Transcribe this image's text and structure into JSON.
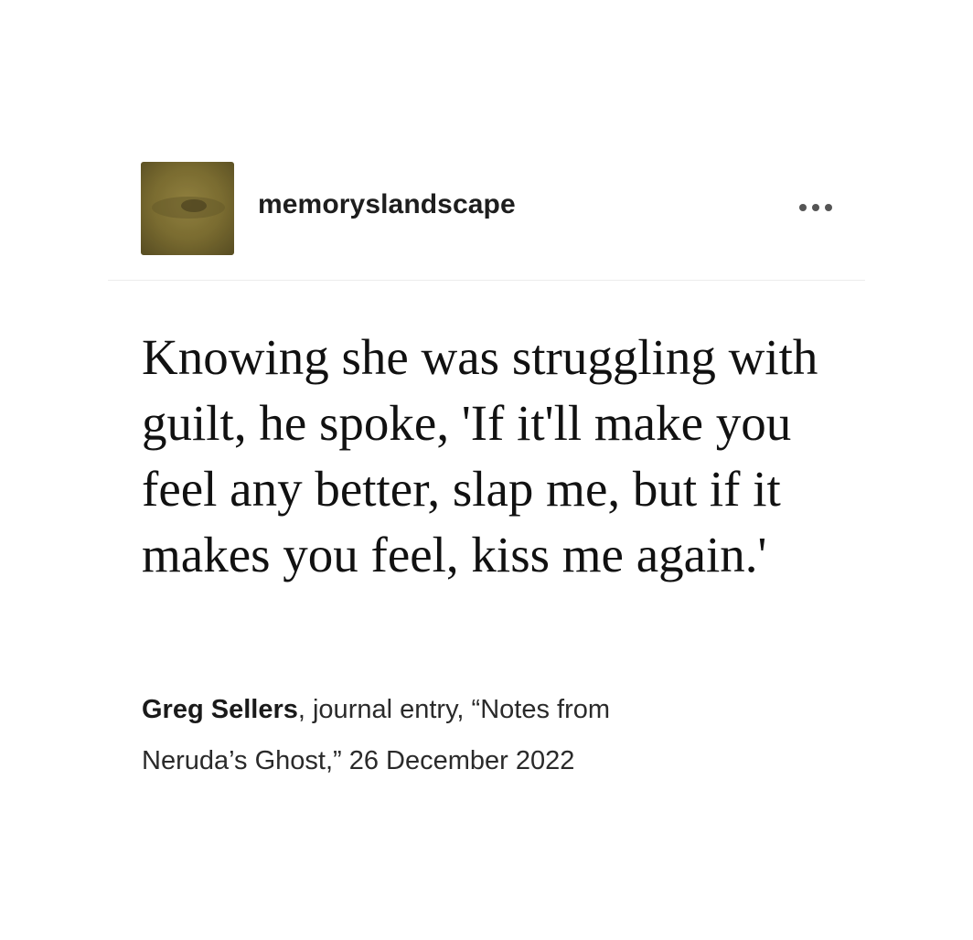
{
  "post": {
    "username": "memoryslandscape",
    "more_icon": "ellipsis-horizontal-icon",
    "quote": "Knowing she was struggling with guilt, he spoke, 'If it'll make you feel any better, slap me, but if it makes you feel, kiss me again.'",
    "source": {
      "author": "Greg Sellers",
      "rest_line1": ", journal entry, “Notes from",
      "rest_line2": "Neruda’s Ghost,” 26 December 2022"
    }
  },
  "colors": {
    "background": "#ffffff",
    "text": "#111111",
    "divider": "#ececec",
    "avatar_tone": "#7a6a2e"
  }
}
